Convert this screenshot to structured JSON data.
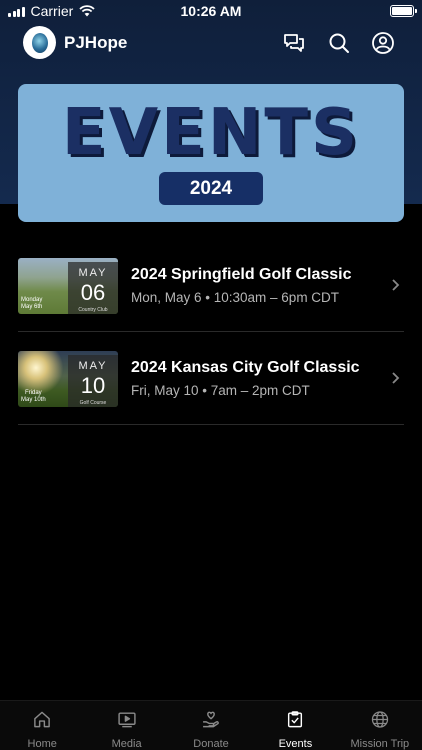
{
  "status_bar": {
    "carrier": "Carrier",
    "time": "10:26 AM"
  },
  "header": {
    "app_name": "PJHope",
    "icons": [
      "chat-icon",
      "search-icon",
      "profile-icon"
    ]
  },
  "banner": {
    "title": "EVENTS",
    "year": "2024"
  },
  "events": [
    {
      "title": "2024 Springfield Golf Classic",
      "subtitle": "Mon, May 6 • 10:30am – 6pm CDT",
      "thumb_month": "MAY",
      "thumb_day": "06",
      "thumb_weekday": "Monday",
      "thumb_date": "May 6th",
      "thumb_venue": "Country Club"
    },
    {
      "title": "2024 Kansas City Golf Classic",
      "subtitle": "Fri, May 10 • 7am – 2pm CDT",
      "thumb_month": "MAY",
      "thumb_day": "10",
      "thumb_weekday": "Friday",
      "thumb_date": "May 10th",
      "thumb_venue": "Golf Course"
    }
  ],
  "tabs": [
    {
      "label": "Home",
      "icon": "home-icon",
      "active": false
    },
    {
      "label": "Media",
      "icon": "media-icon",
      "active": false
    },
    {
      "label": "Donate",
      "icon": "donate-icon",
      "active": false
    },
    {
      "label": "Events",
      "icon": "events-icon",
      "active": true
    },
    {
      "label": "Mission Trip",
      "icon": "globe-icon",
      "active": false
    }
  ],
  "colors": {
    "banner": "#7fb1d8",
    "banner_text": "#1b2f63",
    "header_bg": "#122647",
    "background": "#000000"
  }
}
